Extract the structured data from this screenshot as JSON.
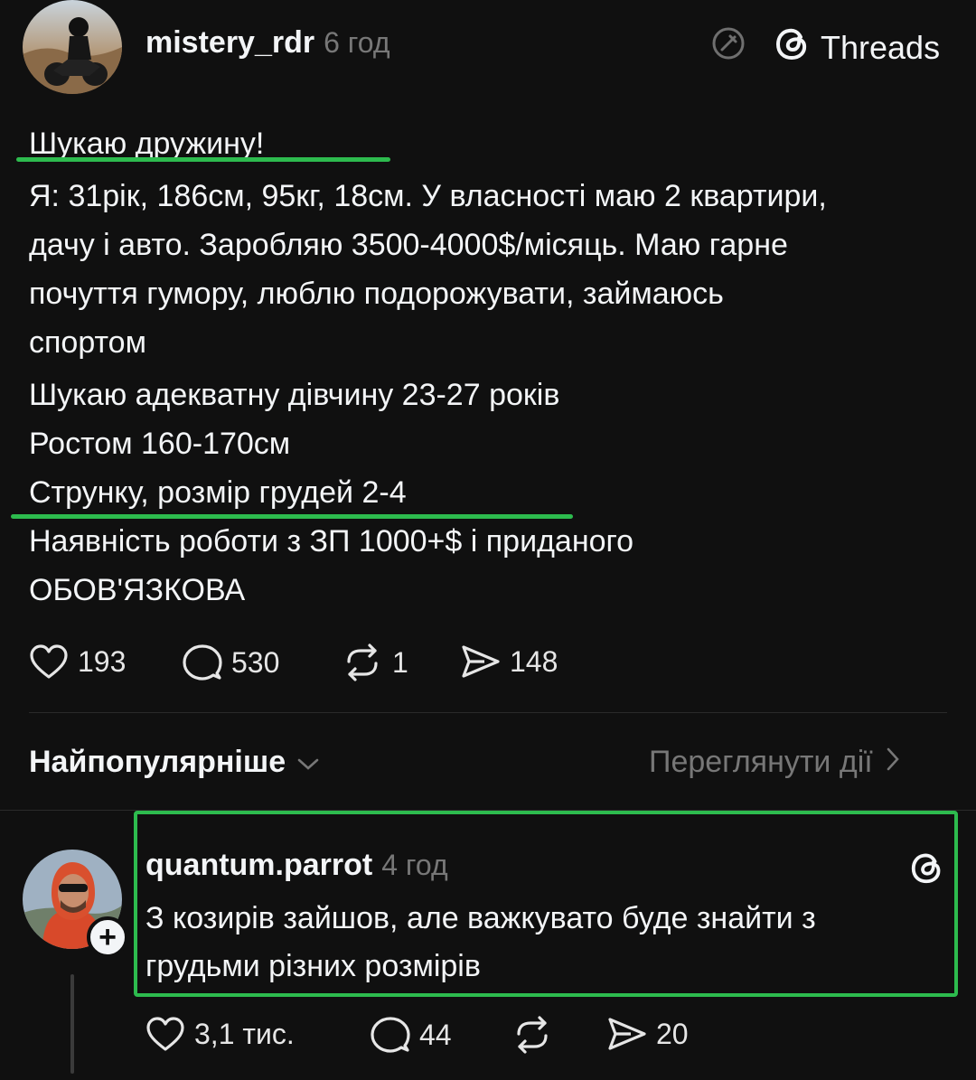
{
  "post": {
    "username": "mistery_rdr",
    "time": "6 год",
    "brand": "Threads",
    "lines": [
      "Шукаю дружину!",
      "Я: 31рік, 186см, 95кг, 18см. У власності маю 2 квартири,",
      "дачу і авто. Заробляю 3500-4000$/місяць. Маю гарне",
      "почуття гумору, люблю подорожувати, займаюсь",
      "спортом",
      "Шукаю адекватну дівчину 23-27 років",
      "Ростом 160-170см",
      "Струнку, розмір грудей 2-4",
      "Наявність роботи з ЗП 1000+$ і приданого",
      "ОБОВ'ЯЗКОВА"
    ],
    "likes": "193",
    "comments": "530",
    "reposts": "1",
    "shares": "148"
  },
  "sort": {
    "label": "Найпопулярніше",
    "activity_link": "Переглянути дії"
  },
  "reply": {
    "username": "quantum.parrot",
    "time": "4 год",
    "lines": [
      "З козирів зайшов, але важкувато буде знайти з",
      "грудьми різних розмірів"
    ],
    "likes": "3,1 тис.",
    "comments": "44",
    "shares": "20"
  },
  "colors": {
    "background": "#101010",
    "highlight": "#2dbb4e",
    "muted": "#777777",
    "text": "#f3f5f7"
  },
  "icons": {
    "edit": "edit-off-icon",
    "threads": "threads-logo-icon",
    "like": "heart-icon",
    "comment": "comment-icon",
    "repost": "repost-icon",
    "share": "share-icon",
    "chevron_down": "chevron-down-icon",
    "chevron_right": "chevron-right-icon",
    "follow": "plus-icon"
  }
}
